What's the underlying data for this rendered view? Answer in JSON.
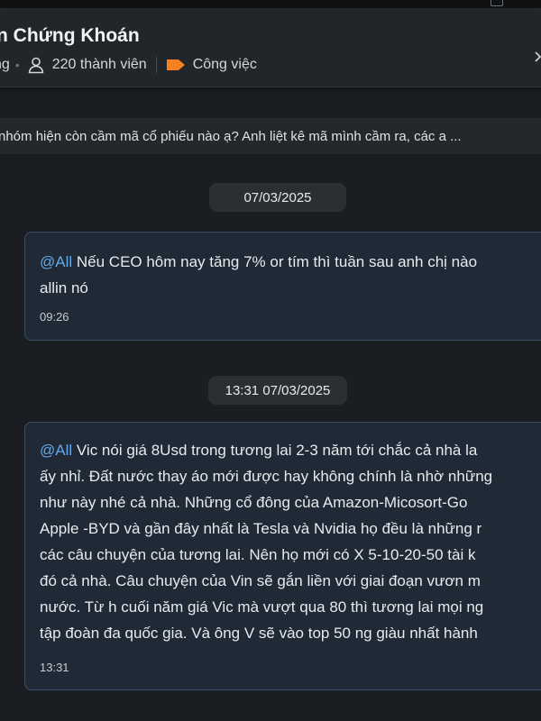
{
  "header": {
    "group_name": "n Chứng Khoán",
    "meta_prefix": "ng",
    "members": "220 thành viên",
    "category": "Công việc",
    "icons": {
      "members": "person-icon",
      "category": "label-tag-icon",
      "close": "close-icon"
    },
    "category_color": "#f5811f"
  },
  "pinned": {
    "text": "nhóm hiện còn cầm mã cổ phiếu nào ạ? Anh liệt kê mã mình cầm ra, các a ..."
  },
  "messages": [
    {
      "date": "07/03/2025",
      "mention": "@All",
      "lines": [
        " Nếu CEO hôm nay tăng 7% or tím thì tuần sau anh chị nào",
        "allin nó"
      ],
      "time": "09:26"
    },
    {
      "date": "13:31 07/03/2025",
      "mention": "@All",
      "lines": [
        " Vic nói giá 8Usd trong tương lai 2-3 năm tới chắc cả nhà la",
        "ấy nhỉ. Đất nước thay áo mới được hay không chính là nhờ những",
        "như này nhé cả nhà. Những cổ đông của Amazon-Micosort-Go",
        "Apple -BYD và gần đây nhất là Tesla và Nvidia  họ đều là những r",
        "các câu chuyện của tương lai. Nên họ mới có X 5-10-20-50 tài k",
        "đó cả nhà. Câu chuyện của Vin sẽ gắn liền với  giai đoạn vươn m",
        "nước.  Từ h cuối năm giá Vic mà vượt qua 80 thì tương lai mọi ng",
        "tập đoàn đa quốc gia. Và ông V sẽ vào top 50 ng giàu nhất hành"
      ],
      "time": "13:31"
    }
  ]
}
